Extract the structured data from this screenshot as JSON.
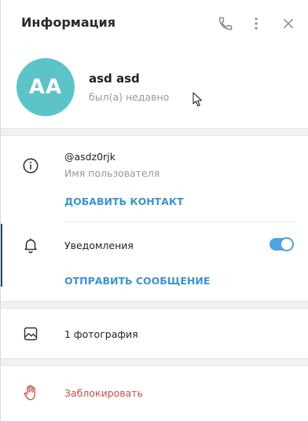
{
  "header": {
    "title": "Информация",
    "icons": [
      "phone-icon",
      "more-vertical-icon",
      "close-icon"
    ]
  },
  "profile": {
    "initials": "AA",
    "avatar_color": "#5cc4c8",
    "name": "asd asd",
    "status": "был(а) недавно"
  },
  "info": {
    "username": "@asdz0rjk",
    "username_caption": "Имя пользователя",
    "add_contact": "ДОБАВИТЬ КОНТАКТ",
    "notifications_label": "Уведомления",
    "notifications_enabled": true,
    "send_message": "ОТПРАВИТЬ СООБЩЕНИЕ"
  },
  "media": {
    "photos_label": "1 фотография"
  },
  "actions": {
    "block_label": "Заблокировать"
  },
  "colors": {
    "accent": "#3b93cf",
    "toggle": "#4ea4e0",
    "danger": "#cc4b4b"
  }
}
